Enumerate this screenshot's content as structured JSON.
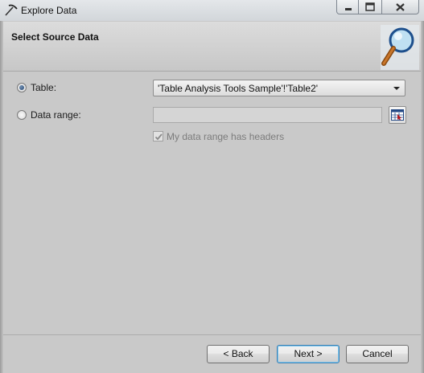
{
  "window": {
    "title": "Explore Data",
    "icons": {
      "app": "pickaxe-icon",
      "minimize": "minimize-icon",
      "maximize": "restore-icon",
      "close": "close-icon"
    }
  },
  "header": {
    "title": "Select Source Data",
    "icon": "magnifier-icon"
  },
  "source": {
    "table_label": "Table:",
    "table_selected": true,
    "table_value": "'Table Analysis Tools Sample'!'Table2'",
    "range_label": "Data range:",
    "range_selected": false,
    "range_value": "",
    "range_button_icon": "range-select-icon",
    "headers_checkbox_label": "My data range has headers",
    "headers_checked": true,
    "headers_enabled": false
  },
  "buttons": {
    "back": "< Back",
    "next": "Next >",
    "cancel": "Cancel"
  },
  "colors": {
    "background": "#c9c9c9",
    "next_focus_border": "#3c7fb1",
    "radio_dot": "#2a4a73"
  }
}
